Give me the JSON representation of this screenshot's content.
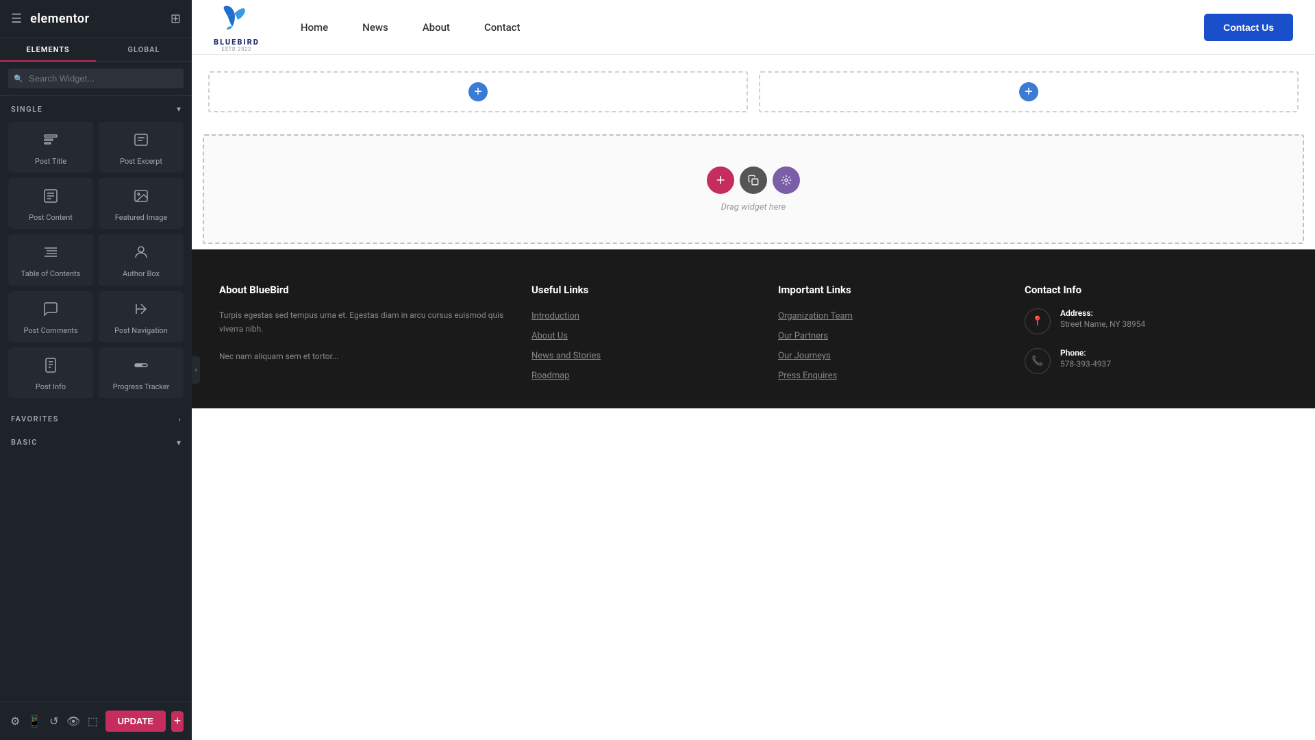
{
  "panel": {
    "logo": "elementor",
    "tabs": [
      {
        "label": "ELEMENTS",
        "active": true
      },
      {
        "label": "GLOBAL",
        "active": false
      }
    ],
    "search_placeholder": "Search Widget...",
    "sections": {
      "single": {
        "title": "SINGLE",
        "widgets": [
          {
            "icon": "📝",
            "label": "Post Title",
            "name": "post-title"
          },
          {
            "icon": "📄",
            "label": "Post Excerpt",
            "name": "post-excerpt"
          },
          {
            "icon": "📋",
            "label": "Post Content",
            "name": "post-content"
          },
          {
            "icon": "🖼️",
            "label": "Featured Image",
            "name": "featured-image"
          },
          {
            "icon": "☰",
            "label": "Table of Contents",
            "name": "table-of-contents"
          },
          {
            "icon": "👤",
            "label": "Author Box",
            "name": "author-box"
          },
          {
            "icon": "💬",
            "label": "Post Comments",
            "name": "post-comments"
          },
          {
            "icon": "⬅️",
            "label": "Post Navigation",
            "name": "post-navigation"
          },
          {
            "icon": "ℹ️",
            "label": "Post Info",
            "name": "post-info"
          },
          {
            "icon": "📊",
            "label": "Progress Tracker",
            "name": "progress-tracker"
          }
        ]
      },
      "favorites": {
        "title": "FAVORITES"
      },
      "basic": {
        "title": "BASIC"
      }
    },
    "toolbar": {
      "update_label": "UPDATE"
    }
  },
  "navbar": {
    "logo_text": "BLUEBIRD",
    "logo_sub": "ESTD 2022",
    "nav_links": [
      {
        "label": "Home"
      },
      {
        "label": "News"
      },
      {
        "label": "About"
      },
      {
        "label": "Contact"
      }
    ],
    "contact_btn": "Contact Us"
  },
  "editor": {
    "drag_text": "Drag widget here",
    "add_btn": "+"
  },
  "footer": {
    "about_col": {
      "title": "About BlueBird",
      "text": "Turpis egestas sed tempus urna et. Egestas diam in arcu cursus euismod quis viverra nibh.\n\nNec nam aliquam sem et tortor..."
    },
    "useful_links_col": {
      "title": "Useful Links",
      "links": [
        {
          "label": "Introduction"
        },
        {
          "label": "About Us"
        },
        {
          "label": "News and Stories"
        },
        {
          "label": "Roadmap"
        }
      ]
    },
    "important_links_col": {
      "title": "Important Links",
      "links": [
        {
          "label": "Organization Team"
        },
        {
          "label": "Our Partners"
        },
        {
          "label": "Our Journeys"
        },
        {
          "label": "Press Enquires"
        }
      ]
    },
    "contact_col": {
      "title": "Contact Info",
      "address_label": "Address:",
      "address_value": "Street Name, NY 38954",
      "phone_label": "Phone:",
      "phone_value": "578-393-4937"
    }
  }
}
